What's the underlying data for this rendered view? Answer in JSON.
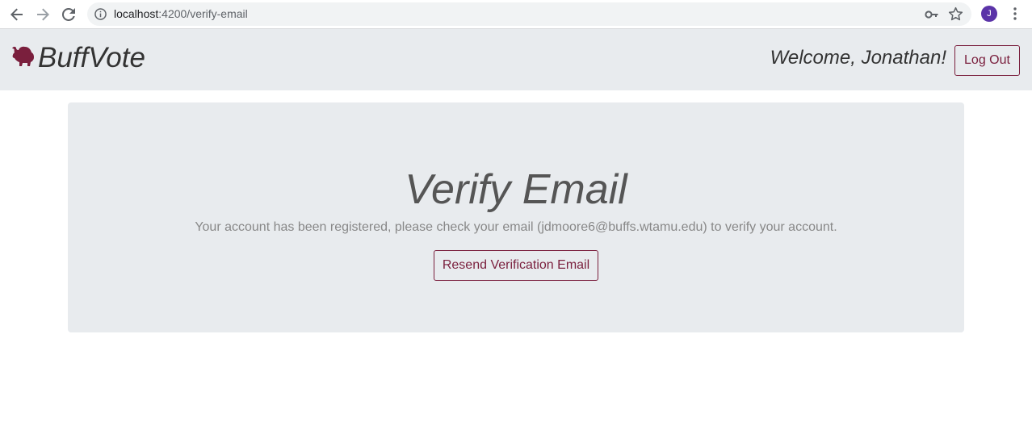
{
  "browser": {
    "url_host": "localhost",
    "url_path": ":4200/verify-email",
    "profile_initial": "J"
  },
  "navbar": {
    "brand": "BuffVote",
    "welcome": "Welcome, Jonathan!",
    "logout_label": "Log Out"
  },
  "main": {
    "title": "Verify Email",
    "message": "Your account has been registered, please check your email (jdmoore6@buffs.wtamu.edu) to verify your account.",
    "resend_label": "Resend Verification Email"
  },
  "colors": {
    "accent": "#7a1f3d",
    "panel": "#e8ebee",
    "profile": "#5b34a8"
  },
  "icons": [
    "back-arrow-icon",
    "forward-arrow-icon",
    "reload-icon",
    "info-icon",
    "key-icon",
    "star-icon",
    "kebab-menu-icon",
    "buffalo-logo-icon"
  ]
}
